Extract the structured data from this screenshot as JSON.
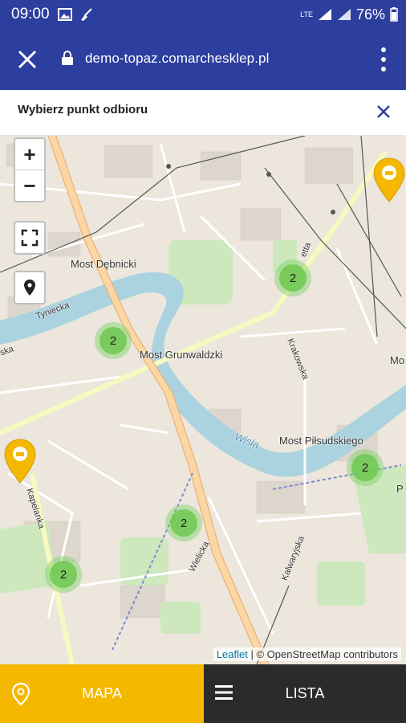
{
  "status_bar": {
    "time": "09:00",
    "network": "LTE",
    "battery": "76%"
  },
  "browser": {
    "url": "demo-topaz.comarchesklep.pl"
  },
  "header": {
    "title": "Wybierz punkt odbioru"
  },
  "map": {
    "zoom_in": "+",
    "zoom_out": "−",
    "street_labels": {
      "most_debnicki": "Most Dębnicki",
      "most_grunwaldzki": "Most Grunwaldzki",
      "most_pilsudskiego": "Most Piłsudskiego",
      "wisla": "Wisła",
      "tyniecka": "Tyniecka",
      "krakowska": "Krakowska",
      "kalwaryjska": "Kalwaryjska",
      "wielicka": "Wielicka",
      "kapelanka": "Kapelanka",
      "mo": "Mo",
      "ska": "ska",
      "etta": "etta",
      "p": "P"
    },
    "clusters": [
      {
        "count": "2"
      },
      {
        "count": "2"
      },
      {
        "count": "2"
      },
      {
        "count": "2"
      },
      {
        "count": "2"
      }
    ],
    "attribution": {
      "leaflet": "Leaflet",
      "osm": "| © OpenStreetMap contributors"
    }
  },
  "tabs": {
    "map_label": "MAPA",
    "list_label": "LISTA"
  }
}
